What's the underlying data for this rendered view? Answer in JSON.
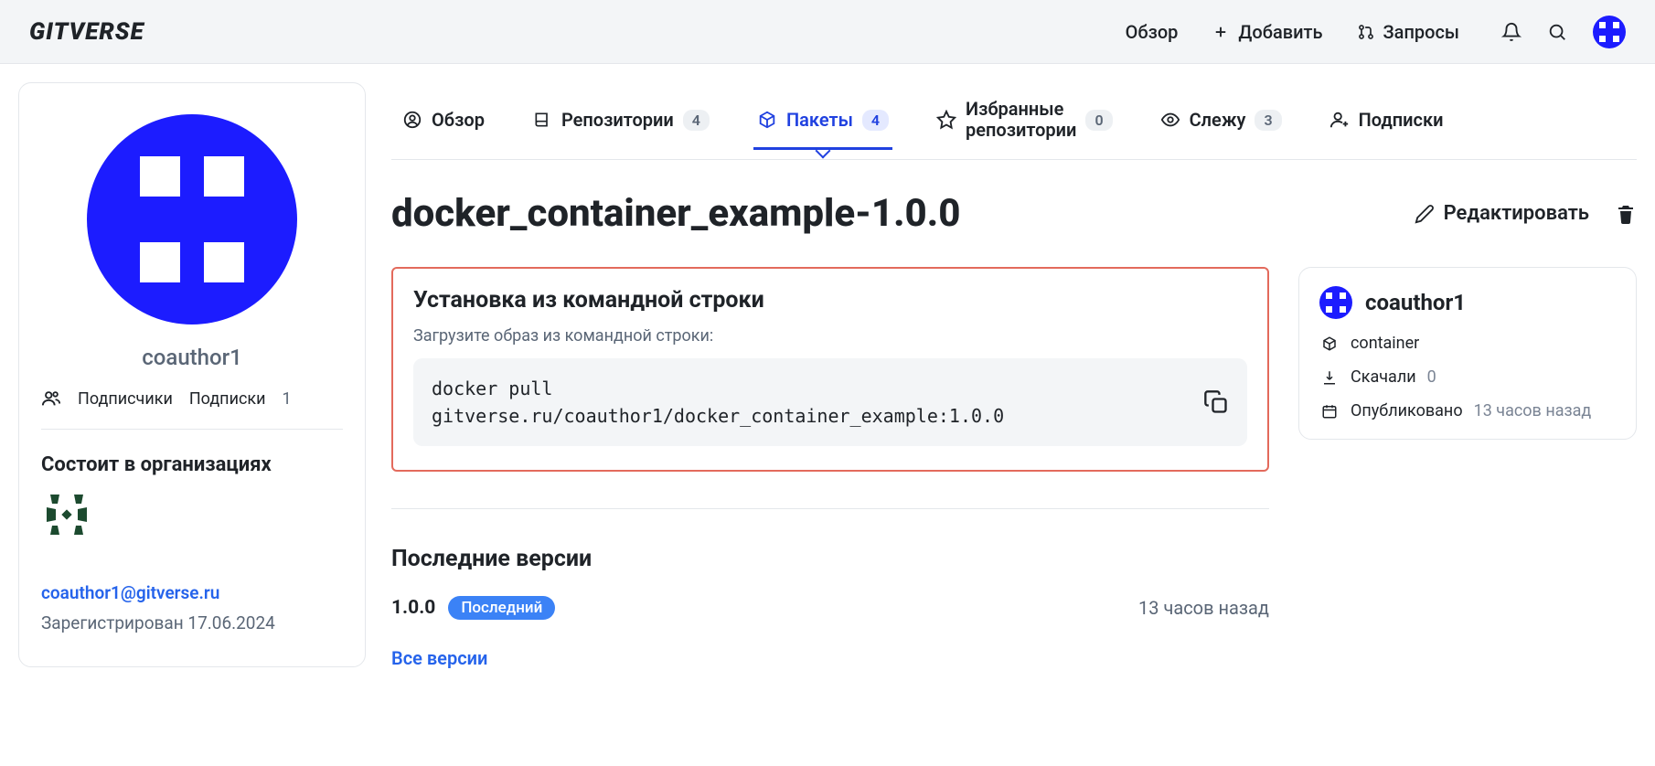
{
  "brand": "GITVERSE",
  "topbar": {
    "overview": "Обзор",
    "add": "Добавить",
    "requests": "Запросы"
  },
  "sidebar": {
    "username": "coauthor1",
    "subscribers": "Подписчики",
    "subscriptions": "Подписки",
    "subscriptions_count": "1",
    "orgs_heading": "Состоит в организациях",
    "email": "coauthor1@gitverse.ru",
    "registered": "Зарегистрирован 17.06.2024"
  },
  "tabs": {
    "overview": "Обзор",
    "repos": "Репозитории",
    "repos_count": "4",
    "packages": "Пакеты",
    "packages_count": "4",
    "starred_line1": "Избранные",
    "starred_line2": "репозитории",
    "starred_count": "0",
    "watching": "Слежу",
    "watching_count": "3",
    "subscriptions": "Подписки"
  },
  "package": {
    "title": "docker_container_example-1.0.0",
    "edit": "Редактировать"
  },
  "install": {
    "heading": "Установка из командной строки",
    "subtitle": "Загрузите образ из командной строки:",
    "command": "docker pull\ngitverse.ru/coauthor1/docker_container_example:1.0.0"
  },
  "versions": {
    "heading": "Последние версии",
    "version": "1.0.0",
    "latest_label": "Последний",
    "time": "13 часов назад",
    "all": "Все версии"
  },
  "meta": {
    "owner": "coauthor1",
    "type": "container",
    "downloads_label": "Скачали",
    "downloads_count": "0",
    "published_label": "Опубликовано",
    "published_time": "13 часов назад"
  }
}
